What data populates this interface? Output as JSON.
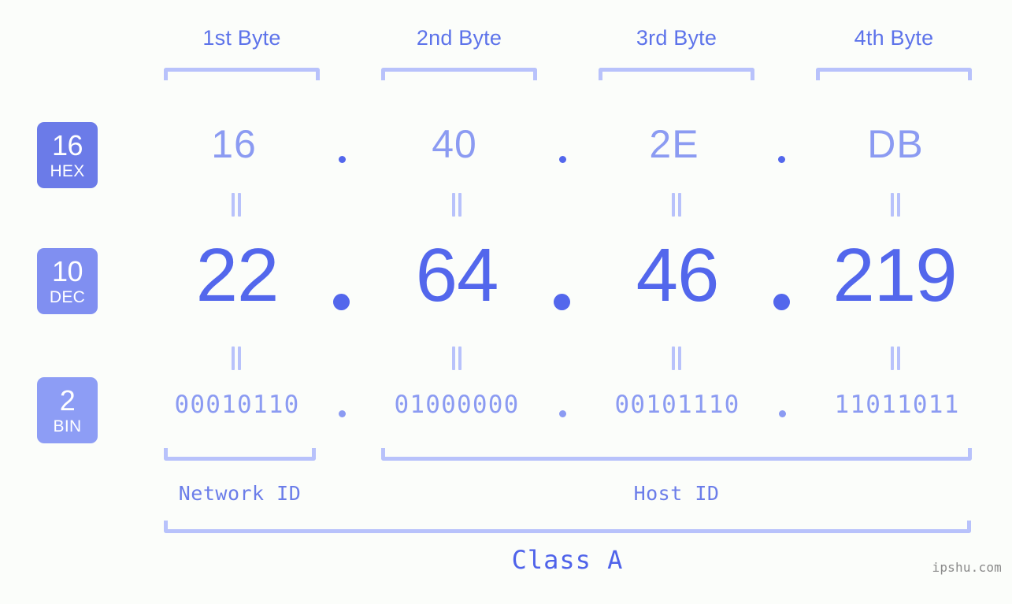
{
  "page": {
    "background": "#fbfdfa",
    "accent_dark": "#5367ec",
    "accent_mid": "#6b7de9",
    "accent_light": "#8b9bf2",
    "accent_pale": "#b8c2fb",
    "watermark": "ipshu.com"
  },
  "headers": {
    "bytes": [
      {
        "label": "1st Byte"
      },
      {
        "label": "2nd Byte"
      },
      {
        "label": "3rd Byte"
      },
      {
        "label": "4th Byte"
      }
    ]
  },
  "bases": [
    {
      "number": "16",
      "name": "HEX",
      "color": "#6b7be8"
    },
    {
      "number": "10",
      "name": "DEC",
      "color": "#808ff1"
    },
    {
      "number": "2",
      "name": "BIN",
      "color": "#8d9df5"
    }
  ],
  "rows": {
    "hex": {
      "base_number": "16",
      "base_name": "HEX",
      "values": [
        "16",
        "40",
        "2E",
        "DB"
      ],
      "separator": "."
    },
    "dec": {
      "base_number": "10",
      "base_name": "DEC",
      "values": [
        "22",
        "64",
        "46",
        "219"
      ],
      "separator": "."
    },
    "bin": {
      "base_number": "2",
      "base_name": "BIN",
      "values": [
        "00010110",
        "01000000",
        "00101110",
        "11011011"
      ],
      "separator": "."
    }
  },
  "equality_marker": "=",
  "sections": [
    {
      "label": "Network ID"
    },
    {
      "label": "Host ID"
    }
  ],
  "class": {
    "label": "Class A"
  }
}
